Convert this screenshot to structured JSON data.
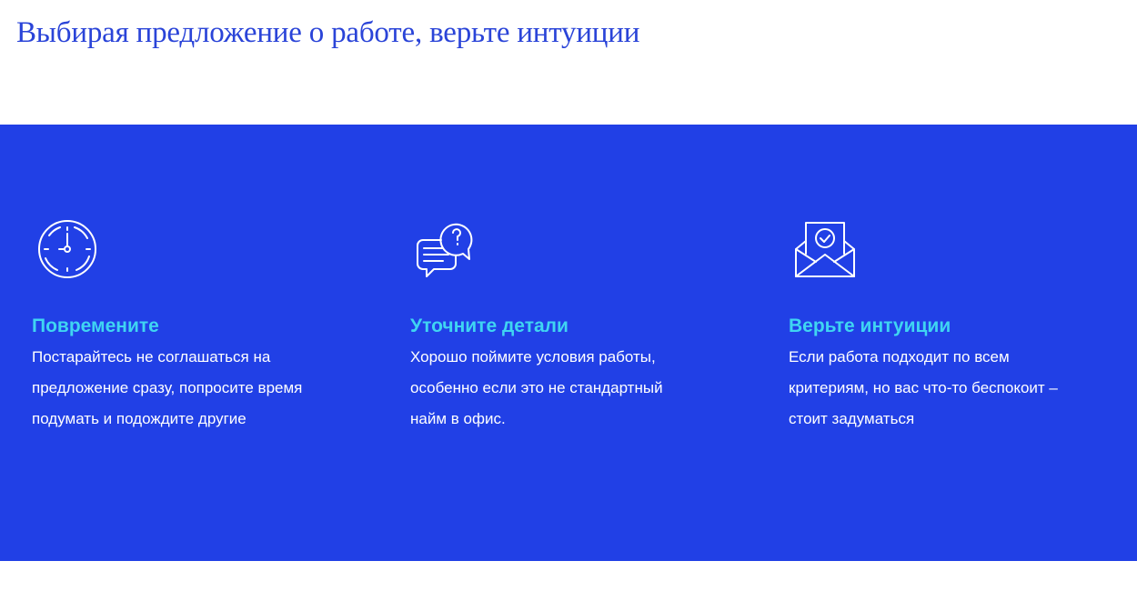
{
  "page": {
    "title": "Выбирая предложение о работе, верьте интуиции"
  },
  "colors": {
    "band": "#2140e6",
    "heading": "#3fd5f2",
    "title": "#2a44d8"
  },
  "features": [
    {
      "icon": "clock-icon",
      "heading": "Повремените",
      "lines": [
        "Постарайтесь не соглашаться на",
        "предложение сразу, попросите время",
        "подумать и подождите другие"
      ]
    },
    {
      "icon": "chat-question-icon",
      "heading": "Уточните детали",
      "lines": [
        "Хорошо поймите условия работы,",
        "особенно если это не стандартный",
        "найм в офис."
      ]
    },
    {
      "icon": "envelope-check-icon",
      "heading": "Верьте интуиции",
      "lines": [
        "Если работа подходит по всем",
        "критериям, но вас что-то беспокоит –",
        "стоит задуматься"
      ]
    }
  ]
}
